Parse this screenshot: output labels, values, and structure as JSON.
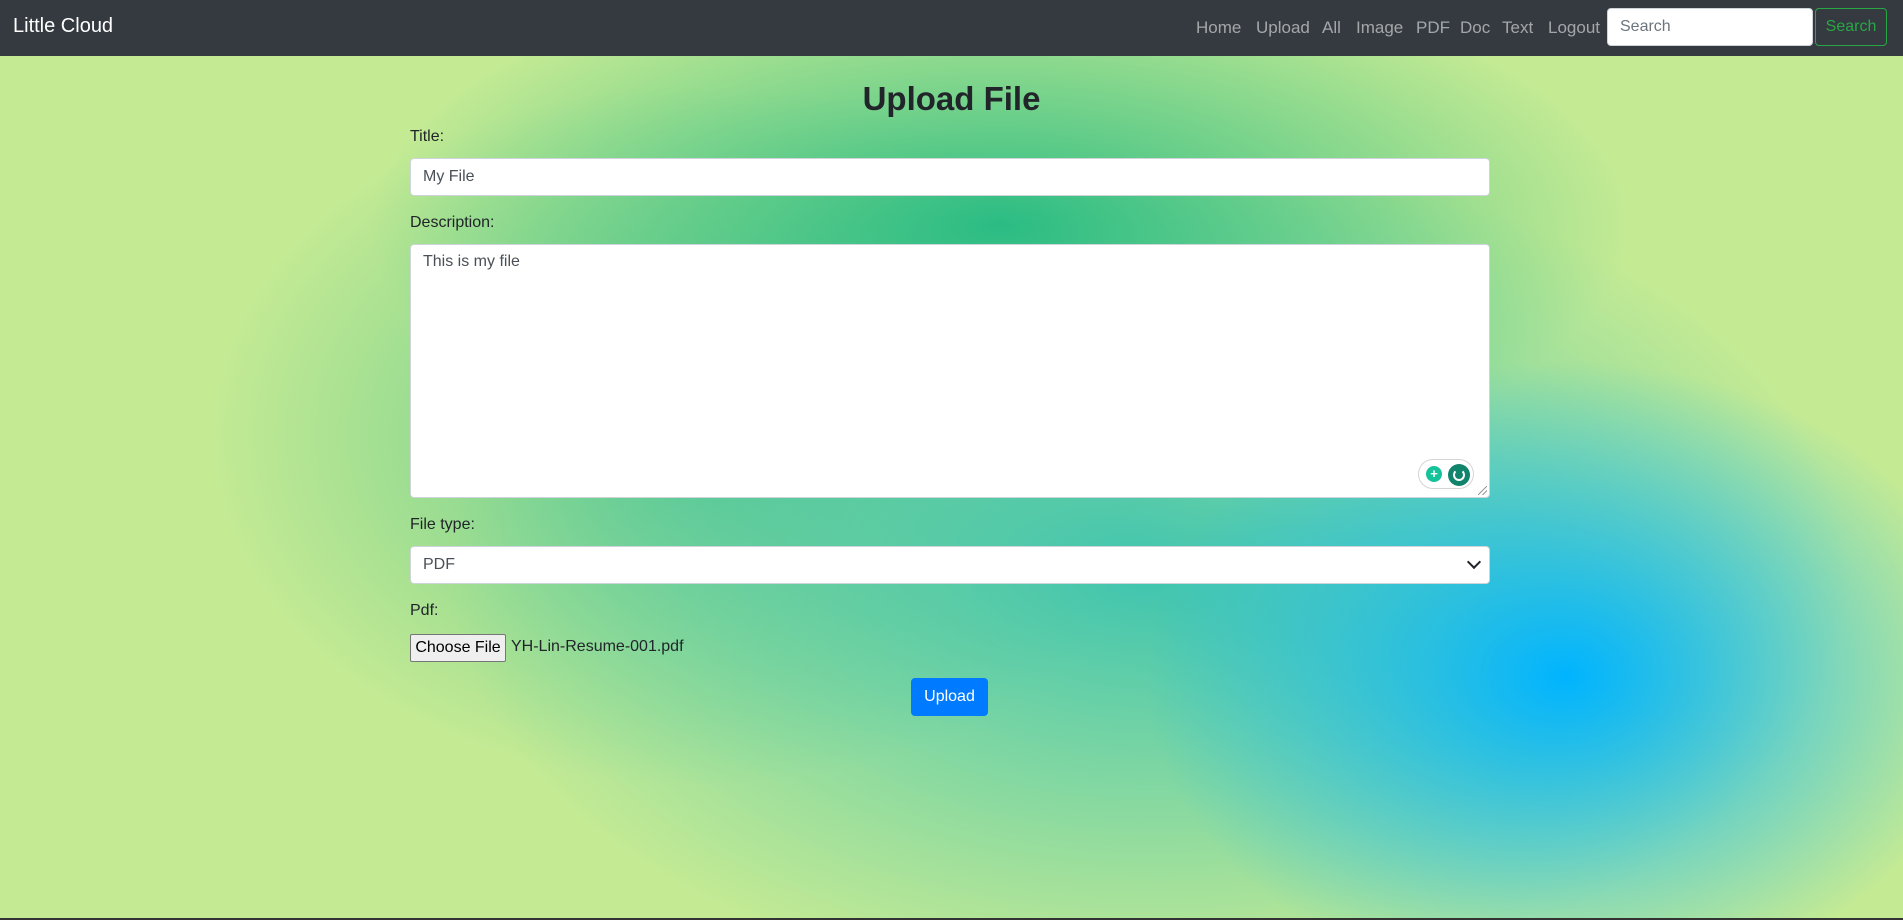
{
  "navbar": {
    "brand": "Little Cloud",
    "links": [
      "Home",
      "Upload",
      "All",
      "Image",
      "PDF",
      "Doc",
      "Text",
      "Logout"
    ],
    "search_placeholder": "Search",
    "search_button": "Search"
  },
  "form": {
    "heading": "Upload File",
    "title_label": "Title:",
    "title_value": "My File",
    "description_label": "Description:",
    "description_value": "This is my file",
    "filetype_label": "File type:",
    "filetype_value": "PDF",
    "file_label": "Pdf:",
    "choose_file_button": "Choose File",
    "file_name": "YH-Lin-Resume-001.pdf",
    "upload_button": "Upload"
  },
  "colors": {
    "navbar_bg": "#343a40",
    "primary": "#007bff",
    "success": "#28a745"
  },
  "icons": {
    "grammarly_suggestion": "lightbulb-icon",
    "grammarly_logo": "grammarly-icon",
    "select_arrow": "chevron-down-icon"
  }
}
